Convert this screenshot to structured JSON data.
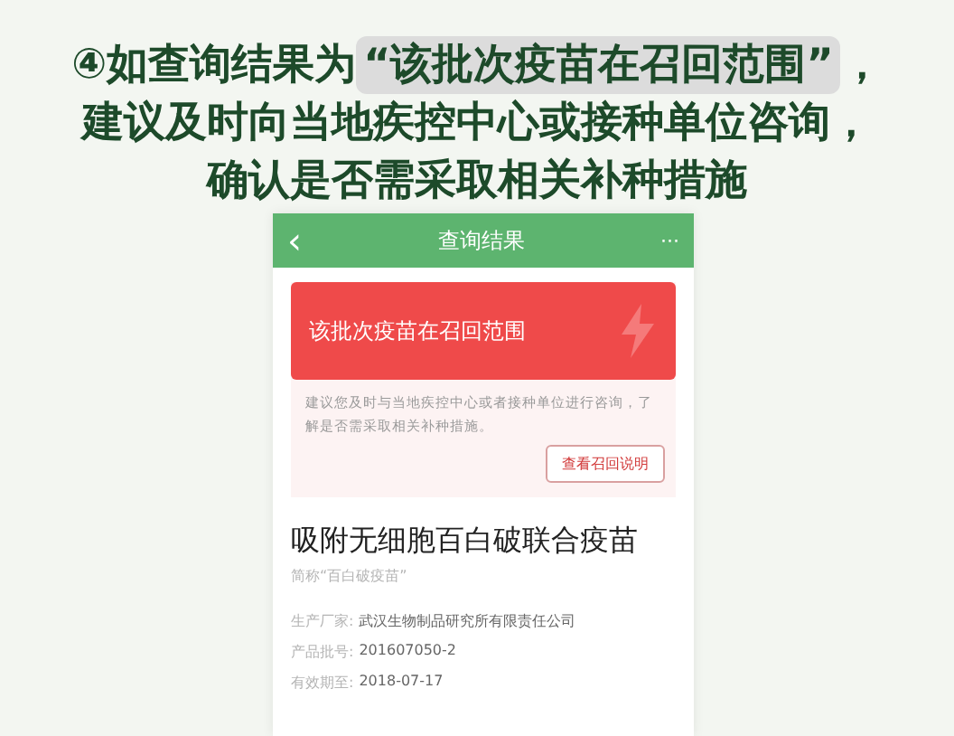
{
  "caption": {
    "line_1": {
      "prefix": "④如查询结果为",
      "highlight": "“该批次疫苗在召回范围”",
      "suffix": "，"
    },
    "line_2": "建议及时向当地疾控中心或接种单位咨询，",
    "line_3": "确认是否需采取相关补种措施"
  },
  "phone": {
    "nav": {
      "back": "‹",
      "title": "查询结果",
      "more": "···"
    },
    "alert": {
      "title": "该批次疫苗在召回范围",
      "advice": "建议您及时与当地疾控中心或者接种单位进行咨询，了解是否需采取相关补种措施。",
      "button": "查看召回说明"
    },
    "product": {
      "name": "吸附无细胞百白破联合疫苗",
      "alias": "简称“百白破疫苗”",
      "fields": [
        {
          "label": "生产厂家:",
          "value": "武汉生物制品研究所有限责任公司"
        },
        {
          "label": "产品批号:",
          "value": "201607050-2"
        },
        {
          "label": "有效期至:",
          "value": "2018-07-17"
        }
      ]
    }
  }
}
